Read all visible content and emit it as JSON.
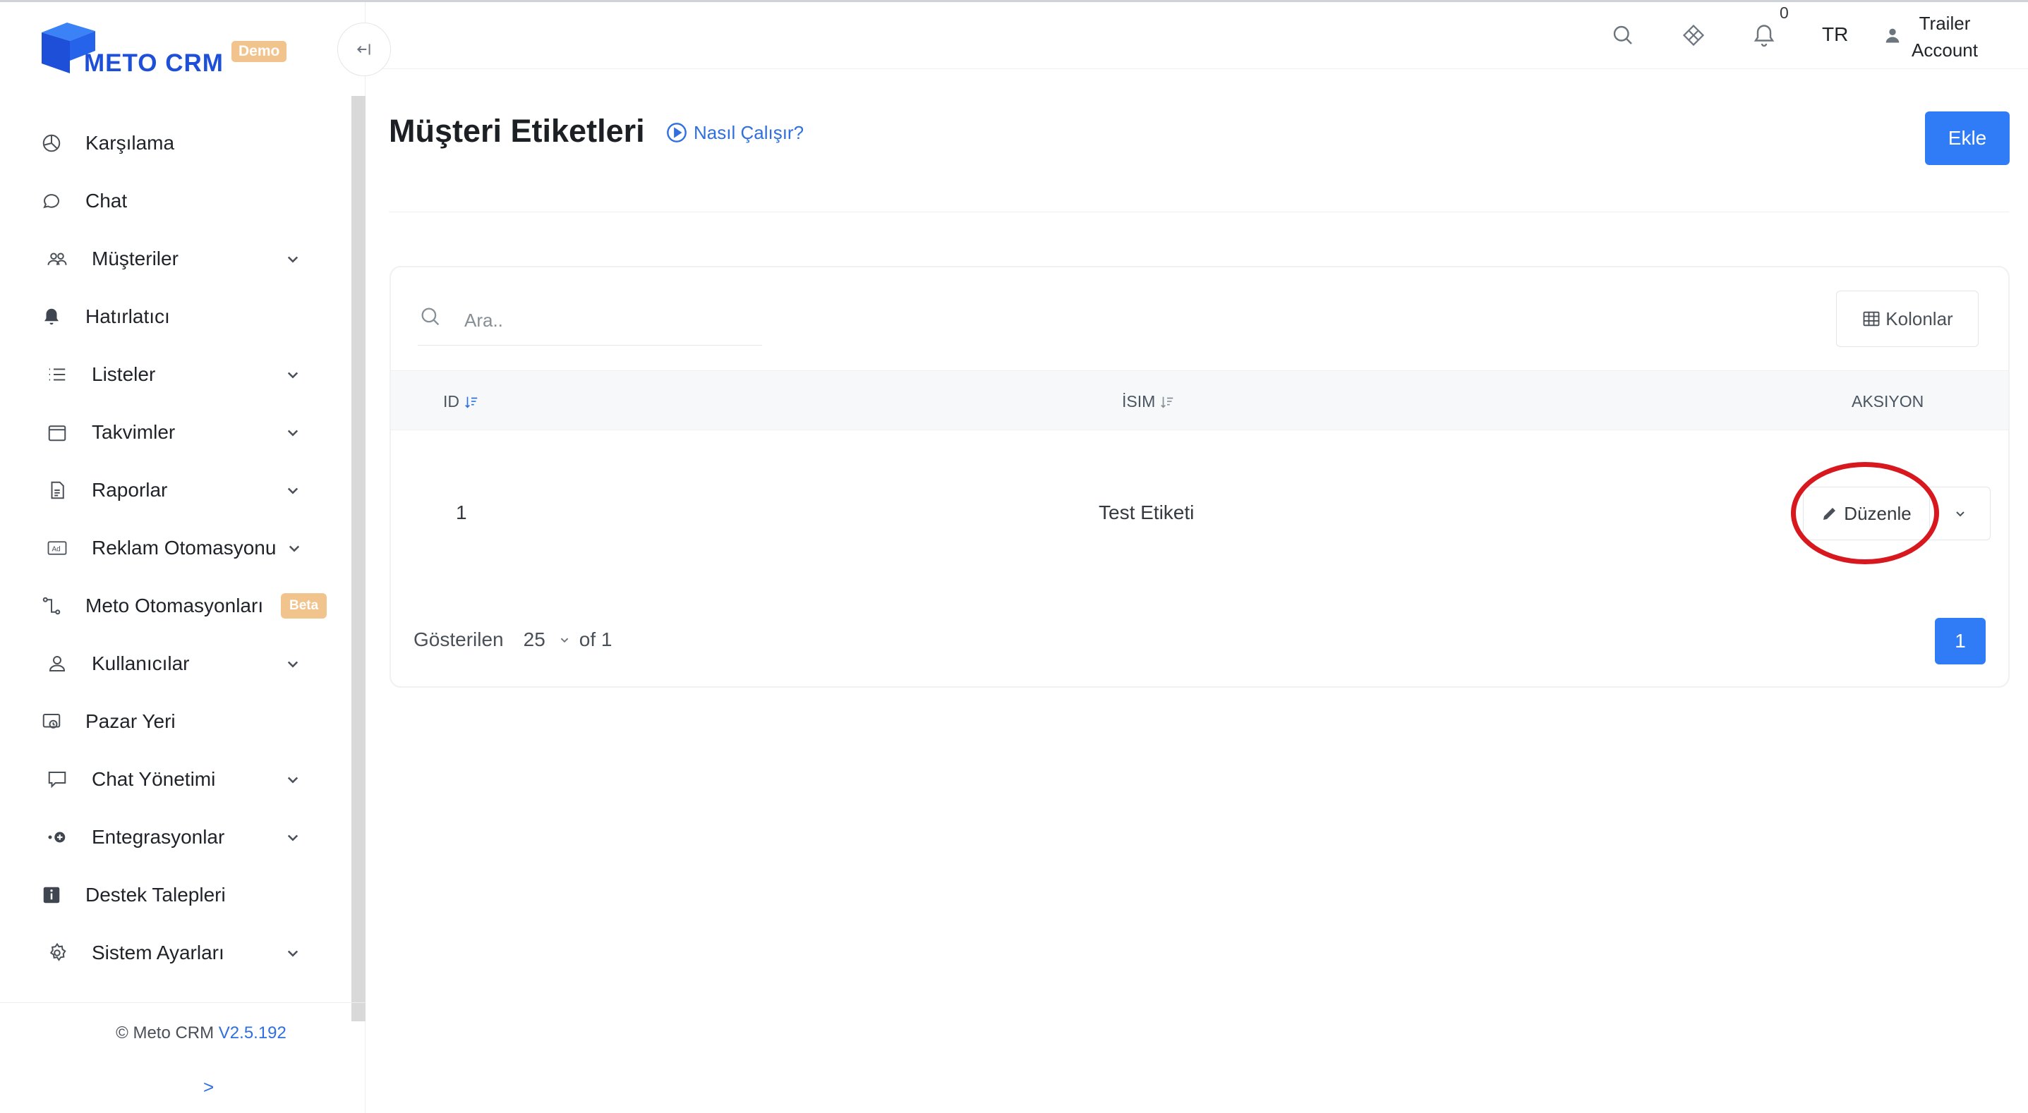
{
  "app": {
    "logo_text": "METO CRM",
    "logo_badge": "Demo",
    "brand_color": "#1d4fd8",
    "accent_color": "#2f7cf6"
  },
  "sidebar": {
    "items": [
      {
        "label": "Karşılama",
        "icon": "pie-chart-icon",
        "has_submenu": false
      },
      {
        "label": "Chat",
        "icon": "chat-bubble-icon",
        "has_submenu": false
      },
      {
        "label": "Müşteriler",
        "icon": "users-icon",
        "has_submenu": true
      },
      {
        "label": "Hatırlatıcı",
        "icon": "bell-icon",
        "has_submenu": false
      },
      {
        "label": "Listeler",
        "icon": "list-icon",
        "has_submenu": true
      },
      {
        "label": "Takvimler",
        "icon": "calendar-icon",
        "has_submenu": true
      },
      {
        "label": "Raporlar",
        "icon": "document-icon",
        "has_submenu": true
      },
      {
        "label": "Reklam Otomasyonu",
        "icon": "ad-icon",
        "has_submenu": true
      },
      {
        "label": "Meto Otomasyonları",
        "icon": "automation-icon",
        "has_submenu": false,
        "badge": "Beta"
      },
      {
        "label": "Kullanıcılar",
        "icon": "user-icon",
        "has_submenu": true
      },
      {
        "label": "Pazar Yeri",
        "icon": "marketplace-icon",
        "has_submenu": false
      },
      {
        "label": "Chat Yönetimi",
        "icon": "chat-settings-icon",
        "has_submenu": true
      },
      {
        "label": "Entegrasyonlar",
        "icon": "integration-icon",
        "has_submenu": true
      },
      {
        "label": "Destek Talepleri",
        "icon": "info-icon",
        "has_submenu": false
      },
      {
        "label": "Sistem Ayarları",
        "icon": "gear-icon",
        "has_submenu": true
      }
    ],
    "copyright": "© Meto CRM",
    "version": "V2.5.192",
    "expand_label": ">"
  },
  "header": {
    "notification_count": "0",
    "language": "TR",
    "user_line1": "Trailer",
    "user_line2": "Account"
  },
  "page": {
    "title": "Müşteri Etiketleri",
    "how_it_works": "Nasıl Çalışır?",
    "add_label": "Ekle"
  },
  "table": {
    "search_placeholder": "Ara..",
    "columns_label": "Kolonlar",
    "headers": {
      "id": "ID",
      "name": "İSIM",
      "action": "AKSIYON"
    },
    "rows": [
      {
        "id": "1",
        "name": "Test Etiketi",
        "edit_label": "Düzenle"
      }
    ],
    "footer": {
      "showing_label": "Gösterilen",
      "page_size": "25",
      "of_label": "of 1",
      "current_page": "1"
    }
  }
}
